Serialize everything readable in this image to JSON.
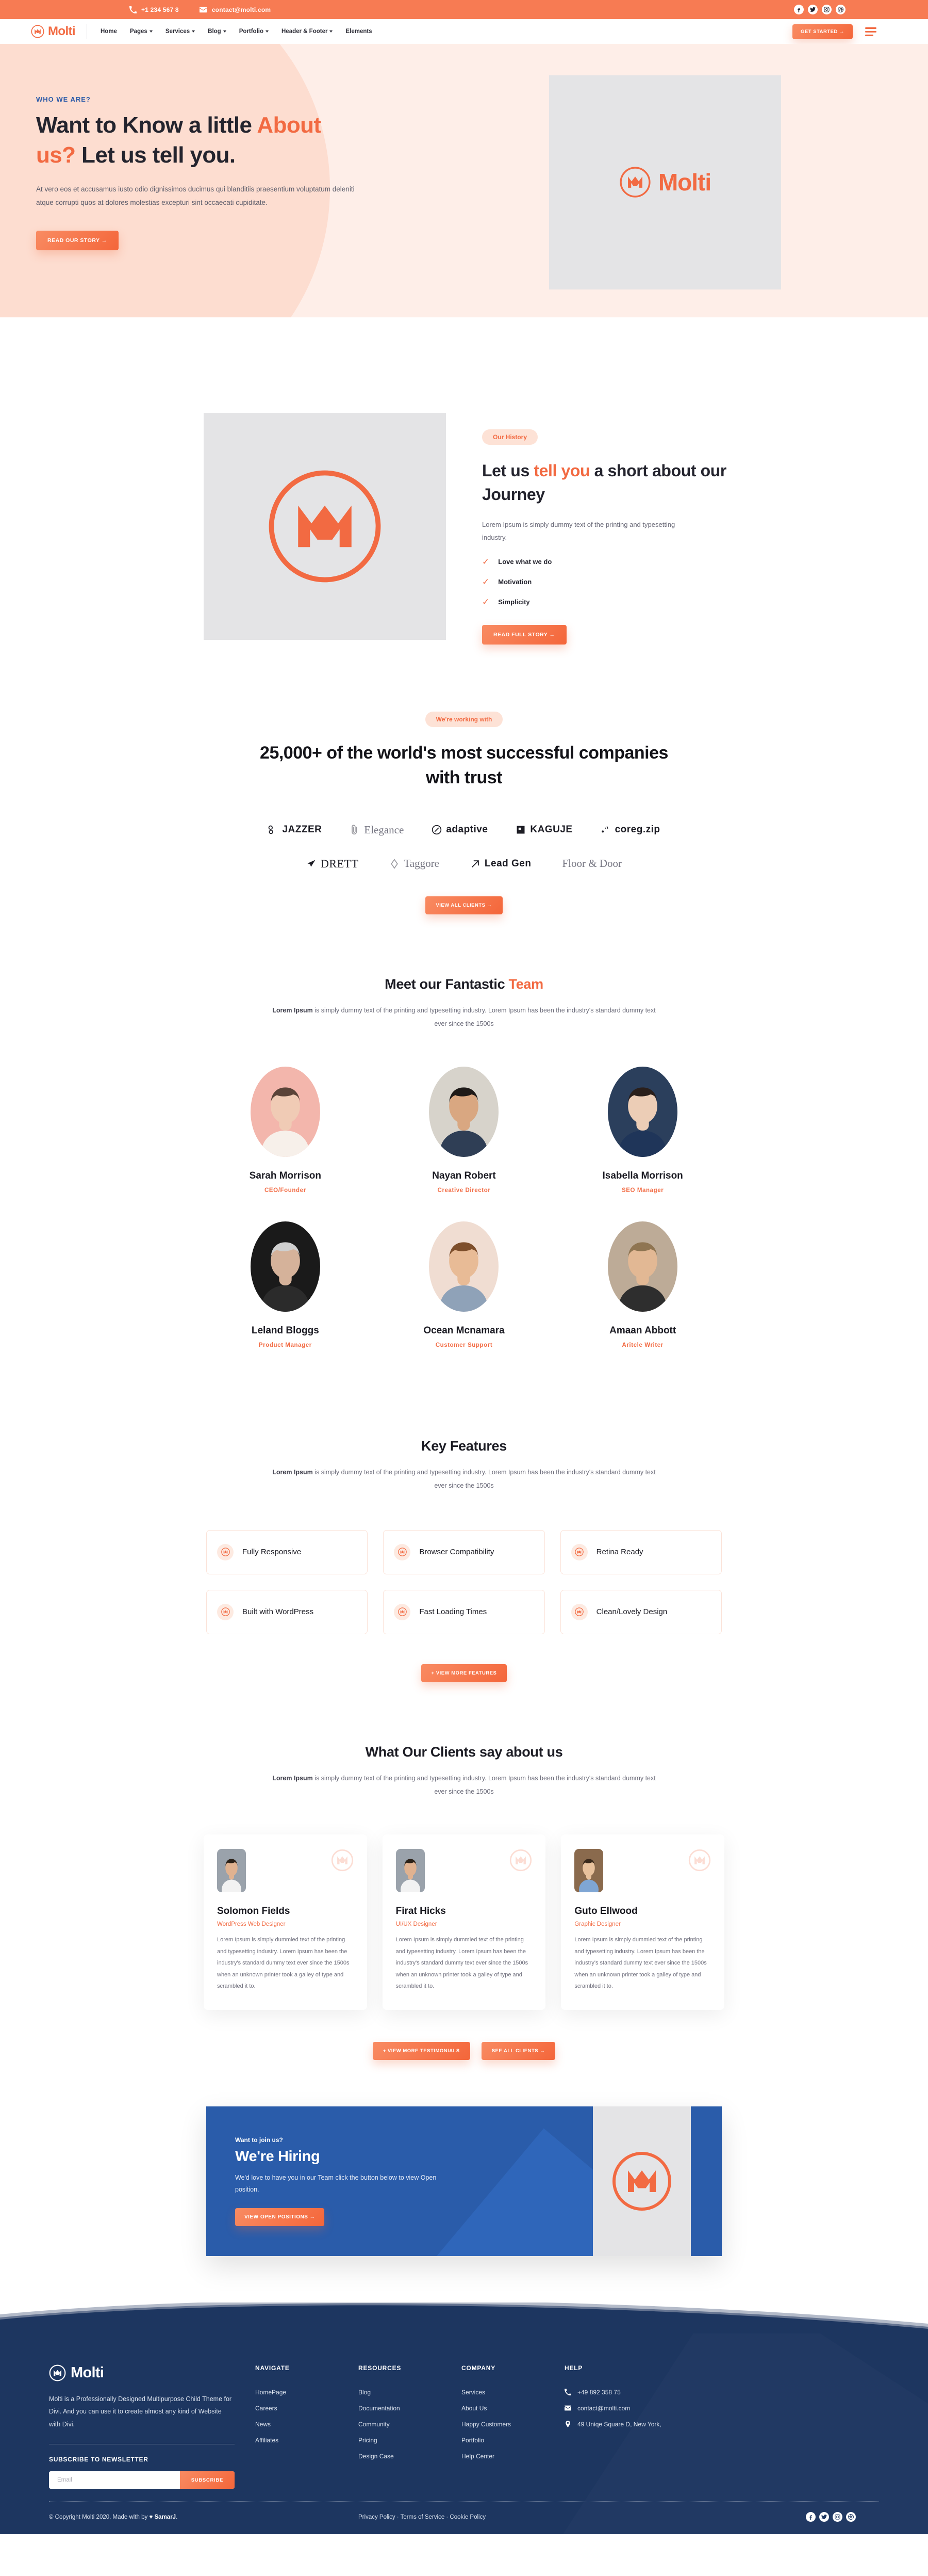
{
  "topbar": {
    "phone": "+1 234 567 8",
    "email": "contact@molti.com",
    "socials": [
      "facebook-icon",
      "twitter-icon",
      "instagram-icon",
      "dribbble-icon"
    ]
  },
  "nav": {
    "brand": "Molti",
    "items": [
      {
        "label": "Home",
        "dropdown": false
      },
      {
        "label": "Pages",
        "dropdown": true
      },
      {
        "label": "Services",
        "dropdown": true
      },
      {
        "label": "Blog",
        "dropdown": true
      },
      {
        "label": "Portfolio",
        "dropdown": true
      },
      {
        "label": "Header & Footer",
        "dropdown": true
      },
      {
        "label": "Elements",
        "dropdown": false
      }
    ],
    "cta": "GET STARTED →"
  },
  "hero": {
    "eyebrow": "WHO WE ARE?",
    "title_1": "Want to Know a little ",
    "title_accent_1": "About us?",
    "title_2": " Let us tell you.",
    "paragraph": "At vero eos et accusamus iusto odio dignissimos ducimus qui blanditiis praesentium voluptatum deleniti atque corrupti quos at dolores molestias excepturi sint occaecati cupiditate.",
    "cta": "READ OUR STORY →",
    "card_logo_text": "Molti"
  },
  "journey": {
    "pill": "Our History",
    "title_1": "Let us ",
    "title_accent": "tell you",
    "title_2": " a short about our Journey",
    "paragraph": "Lorem Ipsum is simply dummy text of the printing and typesetting industry.",
    "checks": [
      "Love what we do",
      "Motivation",
      "Simplicity"
    ],
    "cta": "READ FULL STORY →"
  },
  "trust": {
    "pill": "We're working with",
    "title": "25,000+ of the world's most successful companies with trust",
    "logos_row1": [
      "JAZZER",
      "Elegance",
      "adaptive",
      "KAGUJE",
      "coreg.zip"
    ],
    "logos_row2": [
      "DRETT",
      "Taggore",
      "Lead Gen",
      "Floor & Door"
    ],
    "cta": "VIEW ALL CLIENTS →"
  },
  "team": {
    "title_1": "Meet our Fantastic ",
    "title_accent": "Team",
    "paragraph_bold": "Lorem Ipsum",
    "paragraph": " is simply dummy text of the printing and typesetting industry. Lorem Ipsum has been the industry's standard dummy text ever since the 1500s",
    "members": [
      {
        "name": "Sarah Morrison",
        "role": "CEO/Founder",
        "bg": "#f3b6ac",
        "skin": "#f0cbb5",
        "hair": "#5a4338",
        "shirt": "#f7f0ea"
      },
      {
        "name": "Nayan Robert",
        "role": "Creative Director",
        "bg": "#d7d3cb",
        "skin": "#d9a781",
        "hair": "#1e1a18",
        "shirt": "#2f3e55"
      },
      {
        "name": "Isabella Morrison",
        "role": "SEO Manager",
        "bg": "#2b3f5c",
        "skin": "#eccdb6",
        "hair": "#2a1f1b",
        "shirt": "#1f3559"
      },
      {
        "name": "Leland Bloggs",
        "role": "Product Manager",
        "bg": "#1a1a1a",
        "skin": "#d5b29a",
        "hair": "#cfcfcf",
        "shirt": "#2b2b2b"
      },
      {
        "name": "Ocean Mcnamara",
        "role": "Customer Support",
        "bg": "#f0ddd2",
        "skin": "#e8bb96",
        "hair": "#7e4f2c",
        "shirt": "#8fa2b8"
      },
      {
        "name": "Amaan Abbott",
        "role": "Aritcle Writer",
        "bg": "#bdab97",
        "skin": "#e2b894",
        "hair": "#8f7552",
        "shirt": "#2e2e2e"
      }
    ]
  },
  "features": {
    "title": "Key Features",
    "paragraph_bold": "Lorem Ipsum",
    "paragraph": " is simply dummy text of the printing and typesetting industry. Lorem Ipsum has been the industry's standard dummy text ever since the 1500s",
    "items": [
      "Fully Responsive",
      "Browser Compatibility",
      "Retina Ready",
      "Built with WordPress",
      "Fast Loading Times",
      "Clean/Lovely Design"
    ],
    "cta": "+ VIEW MORE FEATURES"
  },
  "testimonials": {
    "title": "What Our Clients say about us",
    "paragraph_bold": "Lorem Ipsum",
    "paragraph": " is simply dummy text of the printing and typesetting industry. Lorem Ipsum has been the industry's standard dummy text ever since the 1500s",
    "items": [
      {
        "name": "Solomon Fields",
        "role": "WordPress Web Designer",
        "text": "Lorem Ipsum is simply dummied text of the printing and typesetting industry. Lorem Ipsum has been the industry's standard dummy text ever since the 1500s when an unknown printer took a galley of type and scrambled it to.",
        "bg": "#9aa2ab",
        "skin": "#e0b290",
        "hair": "#2b2118",
        "shirt": "#f2f2f2"
      },
      {
        "name": "Firat Hicks",
        "role": "UI/UX Designer",
        "text": "Lorem Ipsum is simply dummied text of the printing and typesetting industry. Lorem Ipsum has been the industry's standard dummy text ever since the 1500s when an unknown printer took a galley of type and scrambled it to.",
        "bg": "#9aa2ab",
        "skin": "#e0b290",
        "hair": "#2b2118",
        "shirt": "#f2f2f2"
      },
      {
        "name": "Guto Ellwood",
        "role": "Graphic Designer",
        "text": "Lorem Ipsum is simply dummied text of the printing and typesetting industry. Lorem Ipsum has been the industry's standard dummy text ever since the 1500s when an unknown printer took a galley of type and scrambled it to.",
        "bg": "#8a6a4d",
        "skin": "#e8c19c",
        "hair": "#3b2a1c",
        "shirt": "#7fa6d4"
      }
    ],
    "cta_more": "+ VIEW MORE TESTIMONIALS",
    "cta_clients": "SEE ALL CLIENTS →"
  },
  "hiring": {
    "kicker": "Want to join us?",
    "title": "We're Hiring",
    "paragraph": "We'd love to have you in our Team click the button below to view Open position.",
    "cta": "VIEW OPEN POSITIONS →"
  },
  "footer": {
    "brand": "Molti",
    "description": "Molti is a Professionally Designed  Multipurpose Child Theme for Divi. And you can use it to create almost any kind of Website with Divi.",
    "subscribe_title": "SUBSCRIBE TO NEWSLETTER",
    "email_placeholder": "Email",
    "subscribe_button": "SUBSCRIBE",
    "columns": [
      {
        "title": "NAVIGATE",
        "links": [
          "HomePage",
          "Careers",
          "News",
          "Affiliates"
        ]
      },
      {
        "title": "RESOURCES",
        "links": [
          "Blog",
          "Documentation",
          "Community",
          "Pricing",
          "Design Case"
        ]
      },
      {
        "title": "COMPANY",
        "links": [
          "Services",
          "About Us",
          "Happy Customers",
          "Portfolio",
          "Help Center"
        ]
      }
    ],
    "help_title": "HELP",
    "help_phone": "+49 892 358 75",
    "help_email": "contact@molti.com",
    "help_address": "49 Uniqe Square D, New York,",
    "copyright_1": "© Copyright Molti 2020. Made with by ",
    "copyright_heart": "♥",
    "copyright_2": " SamarJ",
    "copyright_3": ".",
    "legal": "Privacy Policy · Terms of Service · Cookie Policy",
    "socials": [
      "facebook-icon",
      "twitter-icon",
      "instagram-icon",
      "dribbble-icon"
    ]
  },
  "colors": {
    "accent": "#f26a42",
    "topbar": "#f77b53",
    "hero_bg": "#feeee8",
    "blue": "#2a5caa",
    "footer": "#1d3660"
  }
}
